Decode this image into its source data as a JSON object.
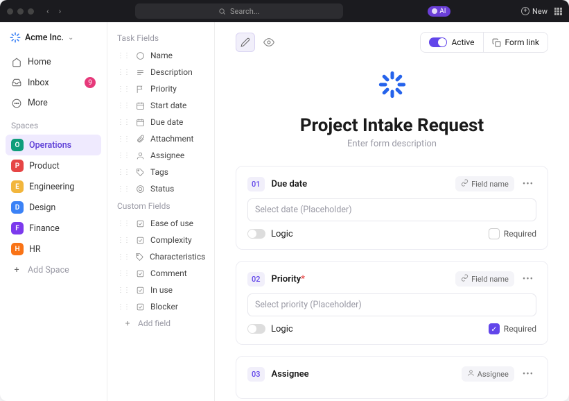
{
  "titlebar": {
    "search_placeholder": "Search...",
    "ai_label": "AI",
    "new_label": "New"
  },
  "workspace": {
    "name": "Acme Inc."
  },
  "nav": {
    "home": "Home",
    "inbox": "Inbox",
    "inbox_badge": "9",
    "more": "More"
  },
  "spaces_label": "Spaces",
  "spaces": [
    {
      "initial": "O",
      "color": "#0f9d7a",
      "label": "Operations",
      "active": true
    },
    {
      "initial": "P",
      "color": "#e64545",
      "label": "Product"
    },
    {
      "initial": "E",
      "color": "#f2b63c",
      "label": "Engineering"
    },
    {
      "initial": "D",
      "color": "#3b82f6",
      "label": "Design"
    },
    {
      "initial": "F",
      "color": "#7c3aed",
      "label": "Finance"
    },
    {
      "initial": "H",
      "color": "#f97316",
      "label": "HR"
    }
  ],
  "add_space": "Add Space",
  "task_fields_label": "Task Fields",
  "task_fields": [
    {
      "icon": "text",
      "label": "Name"
    },
    {
      "icon": "lines",
      "label": "Description"
    },
    {
      "icon": "flag",
      "label": "Priority"
    },
    {
      "icon": "cal",
      "label": "Start date"
    },
    {
      "icon": "cal",
      "label": "Due date"
    },
    {
      "icon": "clip",
      "label": "Attachment"
    },
    {
      "icon": "user",
      "label": "Assignee"
    },
    {
      "icon": "tag",
      "label": "Tags"
    },
    {
      "icon": "target",
      "label": "Status"
    }
  ],
  "custom_fields_label": "Custom Fields",
  "custom_fields": [
    {
      "icon": "check",
      "label": "Ease of use"
    },
    {
      "icon": "check",
      "label": "Complexity"
    },
    {
      "icon": "tag",
      "label": "Characteristics"
    },
    {
      "icon": "check",
      "label": "Comment"
    },
    {
      "icon": "check",
      "label": "In use"
    },
    {
      "icon": "check",
      "label": "Blocker"
    }
  ],
  "add_field": "Add field",
  "toolbar": {
    "active_label": "Active",
    "formlink_label": "Form link"
  },
  "form": {
    "title": "Project Intake Request",
    "description": "Enter form description"
  },
  "cards": [
    {
      "num": "01",
      "title": "Due date",
      "required": false,
      "pill": "Field name",
      "pill_icon": "link",
      "placeholder": "Select date (Placeholder)",
      "logic_label": "Logic",
      "required_label": "Required",
      "required_checked": false
    },
    {
      "num": "02",
      "title": "Priority",
      "required": true,
      "pill": "Field name",
      "pill_icon": "link",
      "placeholder": "Select priority (Placeholder)",
      "logic_label": "Logic",
      "required_label": "Required",
      "required_checked": true
    },
    {
      "num": "03",
      "title": "Assignee",
      "required": false,
      "pill": "Assignee",
      "pill_icon": "user"
    }
  ]
}
